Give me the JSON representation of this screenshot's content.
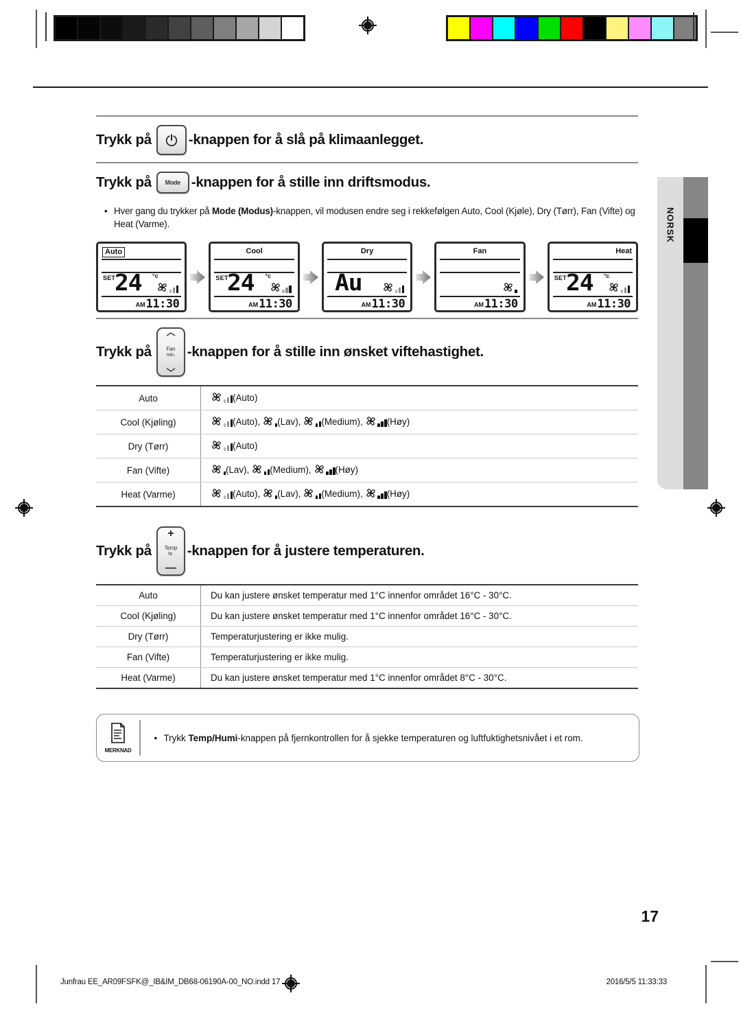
{
  "document": {
    "page_number": "17",
    "side_tab_label": "NORSK",
    "footer_left": "Junfrau EE_AR09FSFK@_IB&IM_DB68-06190A-00_NO.indd   17",
    "footer_right": "2016/5/5   11:33:33"
  },
  "calibration": {
    "grayscale": [
      "#000000",
      "#050505",
      "#0d0d0d",
      "#1a1a1a",
      "#2b2b2b",
      "#424242",
      "#5e5e5e",
      "#808080",
      "#a6a6a6",
      "#d4d4d4",
      "#ffffff"
    ],
    "colors": [
      "#ffff00",
      "#ff00ff",
      "#00ffff",
      "#0000ff",
      "#00e000",
      "#ff0000",
      "#000000",
      "#fff27f",
      "#ff8cff",
      "#8cf5f5",
      "#808080"
    ]
  },
  "sections": [
    {
      "id": "power",
      "text_before": "Trykk på",
      "button": "power-button",
      "text_after": "-knappen for å slå på klimaanlegget."
    },
    {
      "id": "mode",
      "text_before": "Trykk på",
      "button": "mode-button",
      "button_label": "Mode",
      "text_after": "-knappen for å stille inn driftsmodus.",
      "bullets": [
        {
          "pre": "Hver gang du trykker på ",
          "bold": "Mode (Modus)",
          "post": "-knappen, vil modusen endre seg i rekkefølgen Auto, Cool (Kjøle), Dry (Tørr), Fan (Vifte) og Heat (Varme)."
        }
      ]
    },
    {
      "id": "fan",
      "text_before": "Trykk på",
      "button": "fan-speed-button",
      "button_label_top": "Fan",
      "button_label_bottom": "min.",
      "text_after": "-knappen for å stille inn ønsket viftehastighet."
    },
    {
      "id": "temp",
      "text_before": "Trykk på",
      "button": "temp-button",
      "button_label_top": "Temp",
      "button_label_bottom": "hr.",
      "button_plus": "+",
      "button_minus": "—",
      "text_after": "-knappen for å justere temperaturen."
    }
  ],
  "lcd_panels": [
    {
      "mode": "Auto",
      "mode_align": "left",
      "mode_boxed": true,
      "set_label": "SET",
      "temperature": "24",
      "degree": "°c",
      "show_temp": true,
      "show_au": false,
      "au_text": "",
      "fan_bars": "auto",
      "am_label": "AM",
      "time": "11:30"
    },
    {
      "mode": "Cool",
      "mode_align": "center",
      "mode_boxed": false,
      "set_label": "SET",
      "temperature": "24",
      "degree": "°c",
      "show_temp": true,
      "show_au": false,
      "au_text": "",
      "fan_bars": "auto",
      "am_label": "AM",
      "time": "11:30"
    },
    {
      "mode": "Dry",
      "mode_align": "center",
      "mode_boxed": false,
      "set_label": "",
      "temperature": "",
      "degree": "",
      "show_temp": false,
      "show_au": true,
      "au_text": "Au",
      "fan_bars": "auto",
      "am_label": "AM",
      "time": "11:30"
    },
    {
      "mode": "Fan",
      "mode_align": "center",
      "mode_boxed": false,
      "set_label": "",
      "temperature": "",
      "degree": "",
      "show_temp": false,
      "show_au": false,
      "au_text": "",
      "fan_bars": "low",
      "am_label": "AM",
      "time": "11:30"
    },
    {
      "mode": "Heat",
      "mode_align": "right",
      "mode_boxed": false,
      "set_label": "SET",
      "temperature": "24",
      "degree": "°c",
      "show_temp": true,
      "show_au": false,
      "au_text": "",
      "fan_bars": "auto",
      "am_label": "AM",
      "time": "11:30"
    }
  ],
  "fan_table": {
    "rows": [
      {
        "mode": "Auto",
        "options": [
          {
            "bars": "auto",
            "label": "(Auto)"
          }
        ]
      },
      {
        "mode": "Cool (Kjøling)",
        "options": [
          {
            "bars": "auto",
            "label": "(Auto),"
          },
          {
            "bars": "low",
            "label": "(Lav),"
          },
          {
            "bars": "medium",
            "label": "(Medium),"
          },
          {
            "bars": "high",
            "label": "(Høy)"
          }
        ]
      },
      {
        "mode": "Dry (Tørr)",
        "options": [
          {
            "bars": "auto",
            "label": "(Auto)"
          }
        ]
      },
      {
        "mode": "Fan (Vifte)",
        "options": [
          {
            "bars": "low",
            "label": "(Lav),"
          },
          {
            "bars": "medium",
            "label": "(Medium),"
          },
          {
            "bars": "high",
            "label": "(Høy)"
          }
        ]
      },
      {
        "mode": "Heat (Varme)",
        "options": [
          {
            "bars": "auto",
            "label": "(Auto),"
          },
          {
            "bars": "low",
            "label": "(Lav),"
          },
          {
            "bars": "medium",
            "label": "(Medium),"
          },
          {
            "bars": "high",
            "label": "(Høy)"
          }
        ]
      }
    ]
  },
  "temp_table": {
    "rows": [
      {
        "mode": "Auto",
        "desc": "Du kan justere ønsket temperatur med 1°C innenfor området 16°C - 30°C."
      },
      {
        "mode": "Cool (Kjøling)",
        "desc": "Du kan justere ønsket temperatur med 1°C innenfor området 16°C - 30°C."
      },
      {
        "mode": "Dry (Tørr)",
        "desc": "Temperaturjustering er ikke mulig."
      },
      {
        "mode": "Fan (Vifte)",
        "desc": "Temperaturjustering er ikke mulig."
      },
      {
        "mode": "Heat (Varme)",
        "desc": "Du kan justere ønsket temperatur med 1°C innenfor området 8°C - 30°C."
      }
    ]
  },
  "note": {
    "icon_caption": "MERKNAD",
    "bullet": "•",
    "pre": "Trykk ",
    "bold": "Temp/Humi",
    "post": "-knappen på fjernkontrollen for å sjekke temperaturen og luftfuktighetsnivået i et rom."
  }
}
